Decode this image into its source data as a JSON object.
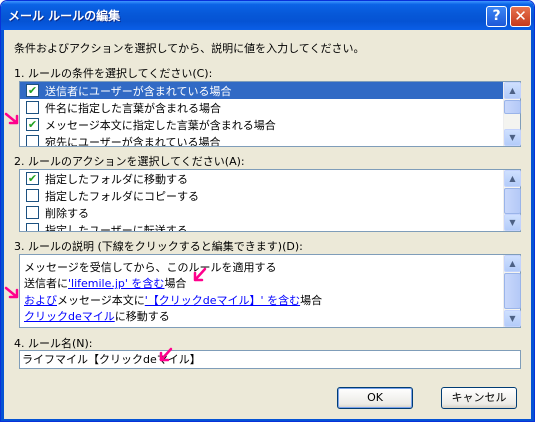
{
  "window": {
    "title": "メール ルールの編集",
    "help_label": "?",
    "close_label": "✕"
  },
  "intro": "条件およびアクションを選択してから、説明に値を入力してください。",
  "section1": {
    "label": "1. ルールの条件を選択してください(C):",
    "items": [
      {
        "text": "送信者にユーザーが含まれている場合",
        "checked": "✔"
      },
      {
        "text": "件名に指定した言葉が含まれる場合",
        "checked": ""
      },
      {
        "text": "メッセージ本文に指定した言葉が含まれる場合",
        "checked": "✔"
      },
      {
        "text": "宛先にユーザーが含まれている場合",
        "checked": ""
      }
    ]
  },
  "section2": {
    "label": "2. ルールのアクションを選択してください(A):",
    "items": [
      {
        "text": "指定したフォルダに移動する",
        "checked": "✔"
      },
      {
        "text": "指定したフォルダにコピーする",
        "checked": ""
      },
      {
        "text": "削除する",
        "checked": ""
      },
      {
        "text": "指定したユーザーに転送する",
        "checked": ""
      }
    ]
  },
  "section3": {
    "label": "3. ルールの説明 (下線をクリックすると編集できます)(D):",
    "line1": "メッセージを受信してから、このルールを適用する",
    "line2_pre": "送信者に",
    "line2_link": "'lifemile.jp' を含む",
    "line2_post": "場合",
    "line3_link1": "および",
    "line3_mid": "メッセージ本文に",
    "line3_link2": "'【クリックdeマイル】' を含む",
    "line3_post": "場合",
    "line4_link": "クリックdeマイル",
    "line4_post": "に移動する"
  },
  "section4": {
    "label": "4. ルール名(N):",
    "value": "ライフマイル【クリックdeマイル】"
  },
  "buttons": {
    "ok": "OK",
    "cancel": "キャンセル"
  },
  "scroll_icons": {
    "up": "▲",
    "down": "▼"
  },
  "colors": {
    "title_blue": "#0553d4",
    "selection": "#316ac5",
    "link": "#0000ff",
    "annotation_arrow": "#ff008c"
  }
}
